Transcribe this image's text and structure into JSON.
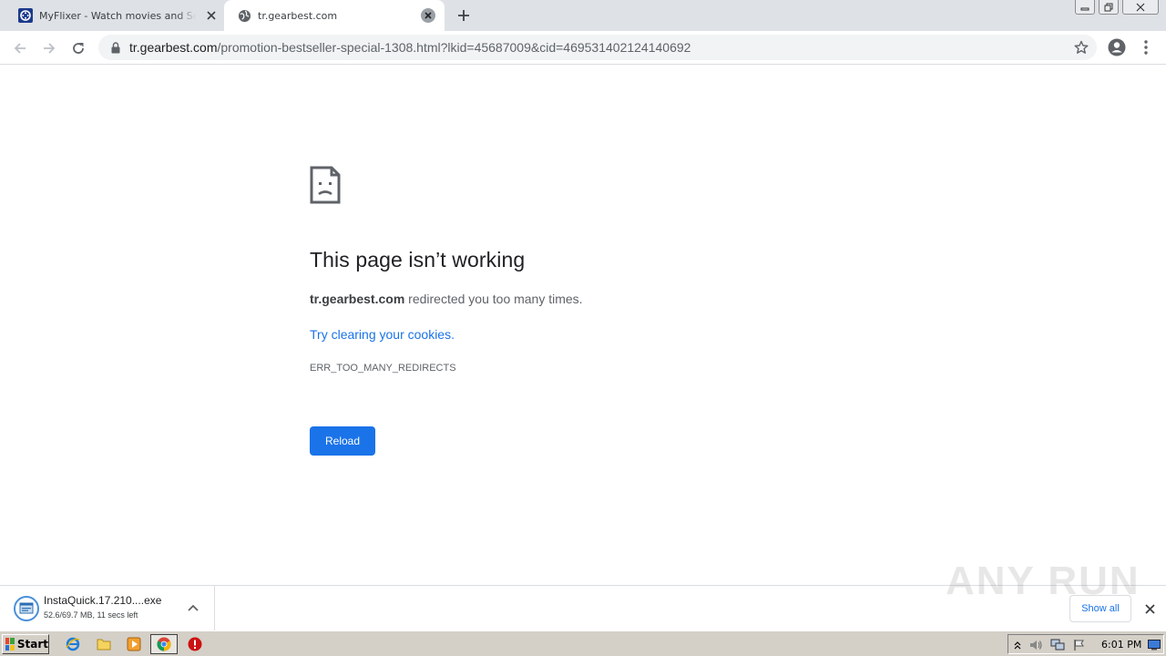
{
  "browser": {
    "tabs": [
      {
        "title": "MyFlixer - Watch movies and Series Online",
        "active": false,
        "favicon": "myflixer-logo-icon"
      },
      {
        "title": "tr.gearbest.com",
        "active": true,
        "favicon": "globe-icon"
      }
    ],
    "address": {
      "host": "tr.gearbest.com",
      "path": "/promotion-bestseller-special-1308.html?lkid=45687009&cid=4695314021241406​92"
    },
    "colors": {
      "accent": "#1a73e8",
      "tabstrip": "#dee1e6"
    }
  },
  "error_page": {
    "title": "This page isn’t working",
    "host_bold": "tr.gearbest.com",
    "desc_rest": " redirected you too many times.",
    "link": "Try clearing your cookies.",
    "code": "ERR_TOO_MANY_REDIRECTS",
    "reload_label": "Reload"
  },
  "download_shelf": {
    "file_name": "InstaQuick.17.210....exe",
    "status": "52.6/69.7 MB, 11 secs left",
    "show_all_label": "Show all",
    "watermark": "ANY RUN"
  },
  "taskbar": {
    "start_label": "Start",
    "clock": "6:01 PM"
  }
}
